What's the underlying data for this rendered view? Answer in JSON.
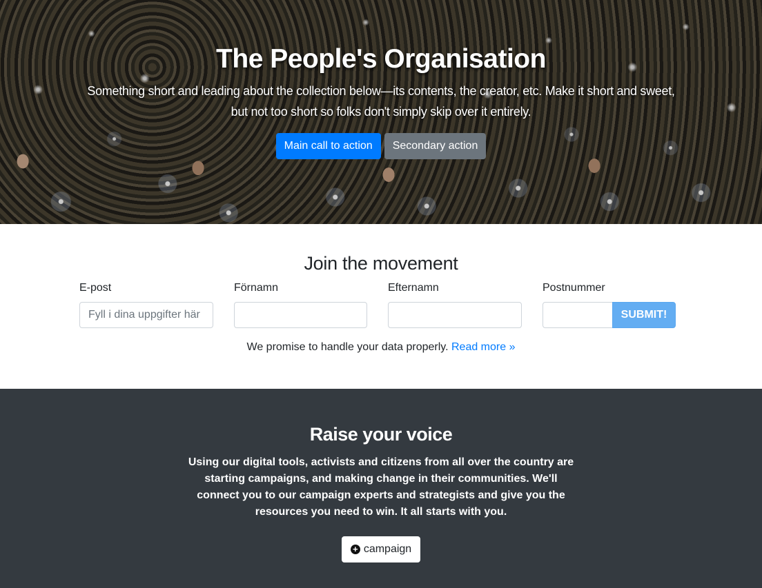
{
  "hero": {
    "title": "The People's Organisation",
    "lead_line1": "Something short and leading about the collection below—its contents, the creator, etc. Make it short and sweet,",
    "lead_line2": "but not too short so folks don't simply skip over it entirely.",
    "primary_button": "Main call to action",
    "secondary_button": "Secondary action"
  },
  "join": {
    "title": "Join the movement",
    "fields": [
      {
        "label": "E-post",
        "placeholder": "Fyll i dina uppgifter här",
        "value": ""
      },
      {
        "label": "Förnamn",
        "placeholder": "",
        "value": ""
      },
      {
        "label": "Efternamn",
        "placeholder": "",
        "value": ""
      },
      {
        "label": "Postnummer",
        "placeholder": "",
        "value": ""
      }
    ],
    "submit_label": "SUBMIT!",
    "privacy_text": "We promise to handle your data properly.",
    "read_more": "Read more »"
  },
  "voice": {
    "title": "Raise your voice",
    "text": "Using our digital tools, activists and citizens from all over the country are starting campaigns, and making change in their communities. We'll connect you to our campaign experts and strategists and give you the resources you need to win. It all starts with you.",
    "button_label": "campaign",
    "button_icon": "plus-circle-icon"
  },
  "colors": {
    "primary": "#007bff",
    "secondary": "#6c757d",
    "submit": "#63adf2",
    "dark_section": "#343a40"
  }
}
